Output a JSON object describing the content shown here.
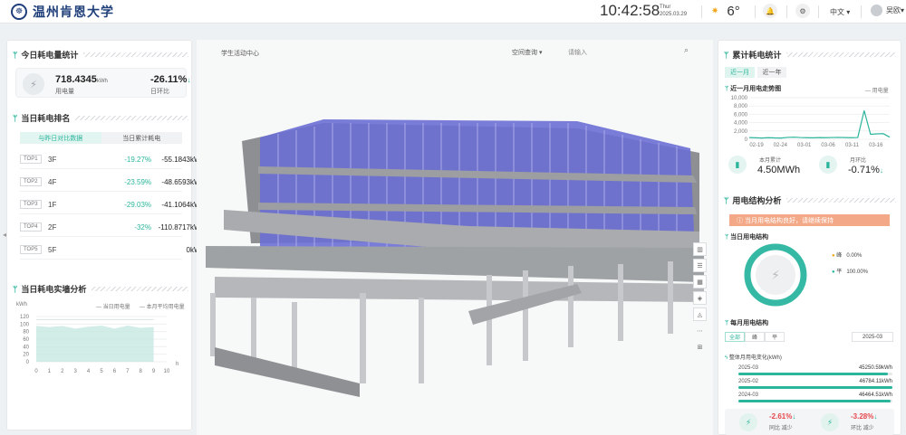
{
  "header": {
    "university_name": "温州肯恩大学",
    "time": "10:42:58",
    "weekday": "Thur",
    "date": "2025.03.29",
    "temperature": "6°",
    "language": "中文",
    "user_name": "吴欧"
  },
  "left": {
    "today_title": "今日耗电量统计",
    "today_usage_value": "718.4345",
    "today_usage_unit": "kWh",
    "today_usage_label": "用电量",
    "today_change_value": "-26.11%",
    "today_change_label": "日环比",
    "rank_title": "当日耗电排名",
    "rank_tabs": [
      "与昨日对比数据",
      "当日累计耗电"
    ],
    "rank_rows": [
      {
        "tag": "TOP1",
        "floor": "3F",
        "pct": "-19.27%",
        "value": "-55.1843kWh"
      },
      {
        "tag": "TOP2",
        "floor": "4F",
        "pct": "-23.59%",
        "value": "-48.6593kWh"
      },
      {
        "tag": "TOP3",
        "floor": "1F",
        "pct": "-29.03%",
        "value": "-41.1064kWh"
      },
      {
        "tag": "TOP4",
        "floor": "2F",
        "pct": "-32%",
        "value": "-110.8717kWh"
      },
      {
        "tag": "TOP5",
        "floor": "5F",
        "pct": "",
        "value": "0kWh"
      }
    ],
    "realtime_title": "当日耗电实墙分析",
    "realtime_chart": {
      "unit": "kWh",
      "legend": [
        "当日用电量",
        "本月平均用电量"
      ],
      "y_ticks": [
        "120",
        "100",
        "80",
        "60",
        "40",
        "20",
        "0"
      ],
      "x_ticks": [
        "0",
        "1",
        "2",
        "3",
        "4",
        "5",
        "6",
        "7",
        "8",
        "9",
        "10"
      ],
      "x_unit": "h"
    }
  },
  "center": {
    "location": "学生活动中心",
    "query_select": "空间查询",
    "query_placeholder": "请输入"
  },
  "right": {
    "cumulative_title": "累计耗电统计",
    "segments": [
      "近一月",
      "近一年"
    ],
    "trend_title": "近一月用电走势图",
    "trend_legend": "用电量",
    "month_total_label": "本月累计",
    "month_total_value": "4.50MWh",
    "month_change_label": "月环比",
    "month_change_value": "-0.71%",
    "structure_title": "用电结构分析",
    "notice": "当月用电结构良好，请继续保持",
    "day_structure_title": "当日用电结构",
    "pie_legend": [
      {
        "name": "峰",
        "pct": "0.00%"
      },
      {
        "name": "平",
        "pct": "100.00%"
      }
    ],
    "month_structure_title": "每月用电结构",
    "month_tabs": [
      "全部",
      "峰",
      "平"
    ],
    "month_selected": "2025-03",
    "overall_change_title": "整体月用电变化(kWh)",
    "monthly_bars": [
      {
        "month": "2025-03",
        "value": "45250.59kWh",
        "ratio": 0.97
      },
      {
        "month": "2025-02",
        "value": "46784.11kWh",
        "ratio": 1.0
      },
      {
        "month": "2024-03",
        "value": "46464.51kWh",
        "ratio": 0.99
      }
    ],
    "yoy_value": "-2.61%",
    "yoy_label": "同比 减少",
    "mom_value": "-3.28%",
    "mom_label": "环比 减少"
  },
  "chart_data": [
    {
      "type": "area",
      "title": "当日耗电实墙分析",
      "ylabel": "kWh",
      "xlabel": "h",
      "ylim": [
        0,
        120
      ],
      "x": [
        0,
        1,
        2,
        3,
        4,
        5,
        6,
        7,
        8,
        9
      ],
      "series": [
        {
          "name": "当日用电量",
          "values": [
            95,
            92,
            95,
            88,
            93,
            96,
            88,
            96,
            90,
            92
          ]
        },
        {
          "name": "本月平均用电量",
          "values": [
            112,
            112,
            112,
            112,
            112,
            112,
            112,
            112,
            112,
            112
          ]
        }
      ]
    },
    {
      "type": "line",
      "title": "近一月用电走势图",
      "ylim": [
        0,
        10000
      ],
      "y_ticks": [
        0,
        2000,
        4000,
        6000,
        8000,
        10000
      ],
      "categories": [
        "02-19",
        "02-24",
        "03-01",
        "03-06",
        "03-11",
        "03-16"
      ],
      "series": [
        {
          "name": "用电量",
          "values": [
            400,
            350,
            300,
            380,
            320,
            300,
            450,
            500,
            420,
            380,
            350,
            400,
            380,
            420,
            450,
            400,
            380,
            420,
            6900,
            1200,
            1300,
            1350,
            500
          ]
        }
      ]
    },
    {
      "type": "pie",
      "title": "当日用电结构",
      "categories": [
        "峰",
        "平"
      ],
      "values": [
        0.0,
        100.0
      ]
    }
  ]
}
